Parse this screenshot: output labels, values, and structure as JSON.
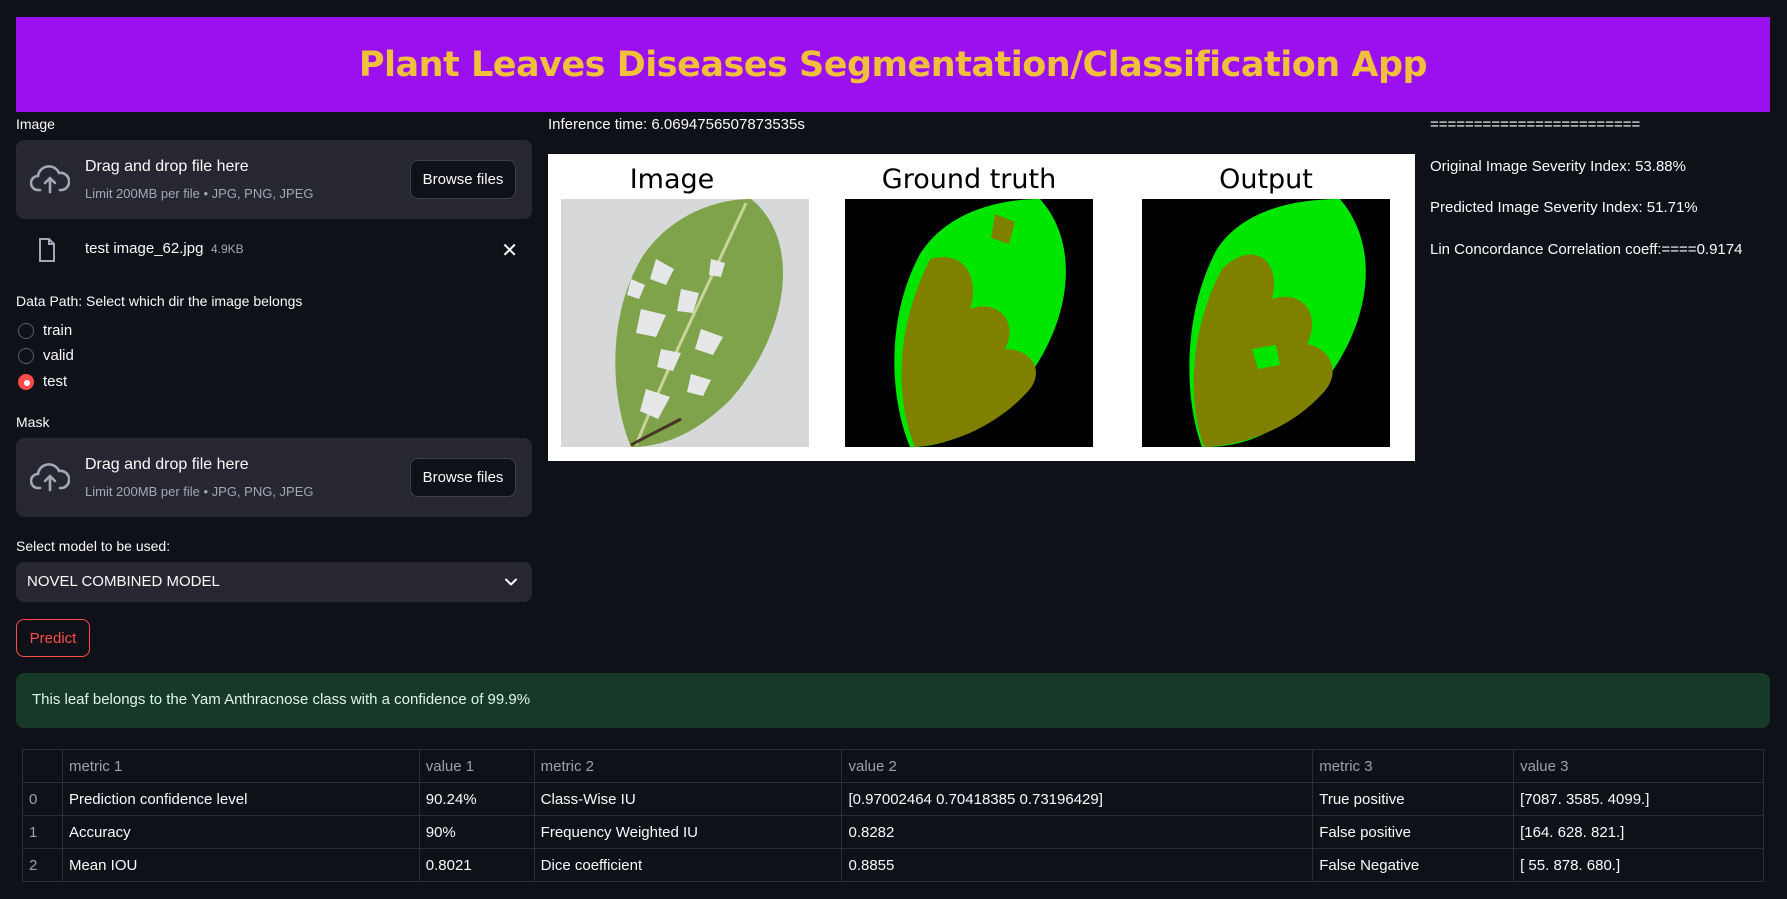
{
  "header": {
    "title": "Plant Leaves Diseases Segmentation/Classification App"
  },
  "image_uploader": {
    "label": "Image",
    "drag_text": "Drag and drop file here",
    "limit_text": "Limit 200MB per file • JPG, PNG, JPEG",
    "browse_label": "Browse files"
  },
  "uploaded_file": {
    "name": "test image_62.jpg",
    "size": "4.9KB",
    "remove_label": "✕"
  },
  "data_path": {
    "label": "Data Path: Select which dir the image belongs",
    "options": [
      {
        "label": "train",
        "selected": false
      },
      {
        "label": "valid",
        "selected": false
      },
      {
        "label": "test",
        "selected": true
      }
    ]
  },
  "mask_uploader": {
    "label": "Mask",
    "drag_text": "Drag and drop file here",
    "limit_text": "Limit 200MB per file • JPG, PNG, JPEG",
    "browse_label": "Browse files"
  },
  "model_select": {
    "label": "Select model to be used:",
    "value": "NOVEL COMBINED MODEL"
  },
  "predict_button": {
    "label": "Predict"
  },
  "inference": {
    "text": "Inference time: 6.0694756507873535s"
  },
  "figure": {
    "panels": [
      {
        "title": "Image"
      },
      {
        "title": "Ground truth"
      },
      {
        "title": "Output"
      }
    ],
    "colors": {
      "healthy": "#00e600",
      "disease": "#808000",
      "background": "#000000"
    }
  },
  "stats": {
    "separator": "========================",
    "original_severity": "Original Image Severity Index: 53.88%",
    "predicted_severity": "Predicted Image Severity Index: 51.71%",
    "lin_coeff": "Lin Concordance Correlation coeff:====0.9174"
  },
  "result": {
    "text": "This leaf belongs to the Yam Anthracnose class with a confidence of 99.9%"
  },
  "metrics_table": {
    "headers": [
      "",
      "metric 1",
      "value 1",
      "metric 2",
      "value 2",
      "metric 3",
      "value 3"
    ],
    "rows": [
      [
        "0",
        "Prediction confidence level",
        "90.24%",
        "Class-Wise IU",
        "[0.97002464 0.70418385 0.73196429]",
        "True positive",
        "[7087. 3585. 4099.]"
      ],
      [
        "1",
        "Accuracy",
        "90%",
        "Frequency Weighted IU",
        "0.8282",
        "False positive",
        "[164. 628. 821.]"
      ],
      [
        "2",
        "Mean IOU",
        "0.8021",
        "Dice coefficient",
        "0.8855",
        "False Negative",
        "[ 55. 878. 680.]"
      ]
    ]
  }
}
